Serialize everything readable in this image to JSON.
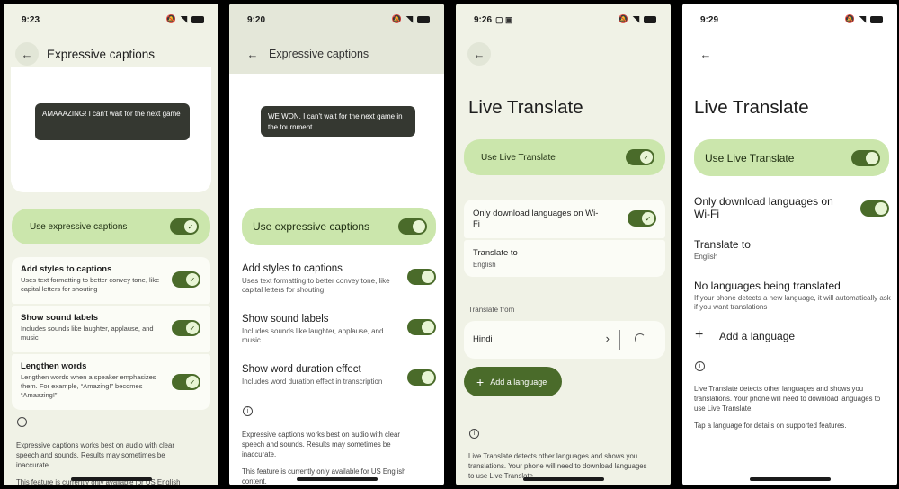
{
  "status_icons": {
    "mute": "🔕",
    "wifi": "wifi-icon",
    "battery": "battery-icon"
  },
  "colors": {
    "accent": "#4a6b2a",
    "switch_bg": "#cbe6ac",
    "page_bg": "#f0f2e6"
  },
  "p1": {
    "time": "9:23",
    "title": "Expressive captions",
    "preview_text": "AMAAAZING! I can't wait for the next game",
    "main_label": "Use expressive captions",
    "items": [
      {
        "title": "Add styles to captions",
        "desc": "Uses text formatting to better convey tone, like capital letters for shouting"
      },
      {
        "title": "Show sound labels",
        "desc": "Includes sounds like laughter, applause, and music"
      },
      {
        "title": "Lengthen words",
        "desc": "Lengthen words when a speaker emphasizes them. For example, “Amazing!” becomes “Amaazing!”"
      }
    ],
    "footer": "Expressive captions works best on audio with clear speech and sounds. Results may sometimes be inaccurate.",
    "footer2": "This feature is currently only available for US English"
  },
  "p2": {
    "time": "9:20",
    "title": "Expressive captions",
    "preview_text": "WE WON. I can't wait for the next game in the tournment.",
    "main_label": "Use expressive captions",
    "items": [
      {
        "title": "Add styles to captions",
        "desc": "Uses text formatting to better convey tone, like capital letters for shouting"
      },
      {
        "title": "Show sound labels",
        "desc": "Includes sounds like laughter, applause, and music"
      },
      {
        "title": "Show word duration effect",
        "desc": "Includes word duration effect in transcription"
      }
    ],
    "footer": "Expressive captions works best on audio with clear speech and sounds. Results may sometimes be inaccurate.",
    "footer2": "This feature is currently only available for US English content."
  },
  "p3": {
    "time": "9:26",
    "title": "Live Translate",
    "main_label": "Use Live Translate",
    "wifi_label": "Only download languages on Wi-Fi",
    "translate_to_label": "Translate to",
    "translate_to_value": "English",
    "translate_from_heading": "Translate from",
    "from_language": "Hindi",
    "add_language": "Add a language",
    "footer": "Live Translate detects other languages and shows you translations. Your phone will need to download languages to use Live Translate."
  },
  "p4": {
    "time": "9:29",
    "title": "Live Translate",
    "main_label": "Use Live Translate",
    "wifi_label": "Only download languages on Wi-Fi",
    "translate_to_label": "Translate to",
    "translate_to_value": "English",
    "no_lang_title": "No languages being translated",
    "no_lang_desc": "If your phone detects a new language, it will automatically ask if you want translations",
    "add_language": "Add a language",
    "footer": "Live Translate detects other languages and shows you translations. Your phone will need to download languages to use Live Translate.",
    "footer2": "Tap a language for details on supported features."
  }
}
